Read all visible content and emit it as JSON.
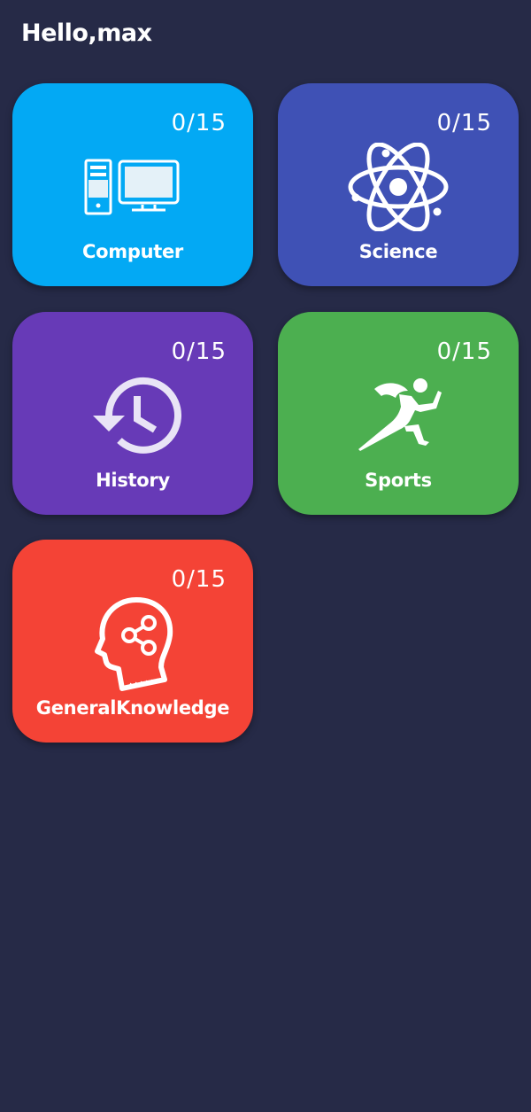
{
  "header": {
    "greeting": "Hello,max"
  },
  "categories": [
    {
      "id": "computer",
      "label": "Computer",
      "progress": "0/15",
      "color": "#03A9F4",
      "icon": "computer-icon"
    },
    {
      "id": "science",
      "label": "Science",
      "progress": "0/15",
      "color": "#3F51B5",
      "icon": "atom-icon"
    },
    {
      "id": "history",
      "label": "History",
      "progress": "0/15",
      "color": "#673AB7",
      "icon": "history-clock-icon"
    },
    {
      "id": "sports",
      "label": "Sports",
      "progress": "0/15",
      "color": "#4CAF50",
      "icon": "runner-icon"
    },
    {
      "id": "general-knowledge",
      "label": "GeneralKnowledge",
      "progress": "0/15",
      "color": "#F44336",
      "icon": "head-share-icon"
    }
  ]
}
